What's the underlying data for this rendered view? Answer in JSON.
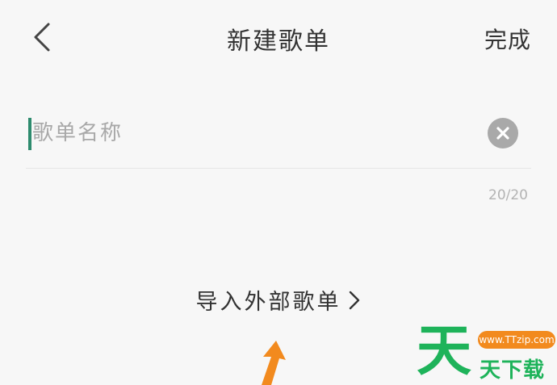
{
  "header": {
    "back_icon": "chevron-left-icon",
    "title": "新建歌单",
    "done_label": "完成"
  },
  "name_field": {
    "value": "",
    "placeholder": "歌单名称",
    "clear_icon": "clear-circle-icon",
    "caret_color": "#2e8b6e"
  },
  "char_counter": "20/20",
  "import": {
    "label": "导入外部歌单",
    "icon": "chevron-right-icon"
  },
  "annotation": {
    "icon": "arrow-up-icon",
    "color": "#f28a1e"
  },
  "watermark": {
    "big_char": "天",
    "url": "www.TTzip.com",
    "text": "天下载",
    "green": "#1eb35a",
    "orange": "#f28a1e"
  }
}
